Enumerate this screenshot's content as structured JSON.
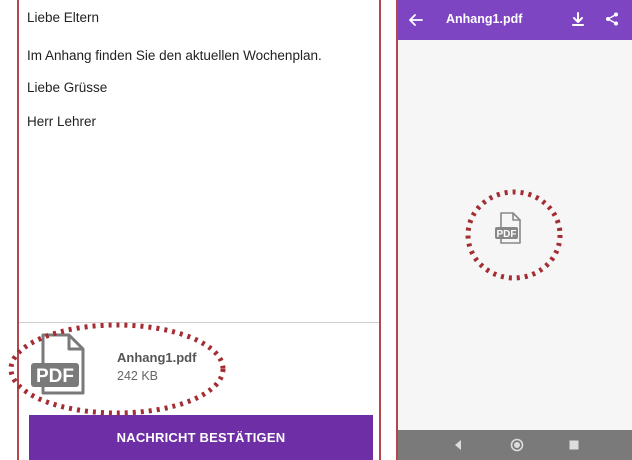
{
  "message": {
    "lines": [
      "Liebe Eltern",
      "Im Anhang finden Sie den aktuellen Wochenplan.",
      "Liebe Grüsse",
      "Herr Lehrer"
    ]
  },
  "attachment": {
    "icon": "pdf-file-icon",
    "icon_text": "PDF",
    "name": "Anhang1.pdf",
    "size": "242 KB"
  },
  "confirm_button": {
    "label": "NACHRICHT BESTÄTIGEN"
  },
  "viewer": {
    "title": "Anhang1.pdf",
    "icons": [
      "back-arrow-icon",
      "download-icon",
      "share-icon"
    ],
    "placeholder_icon": "pdf-file-icon",
    "placeholder_text": "PDF"
  },
  "nav_bar": {
    "icons": [
      "nav-back-icon",
      "nav-home-icon",
      "nav-recent-apps-icon"
    ]
  },
  "colors": {
    "accent_purple": "#6e2fa6",
    "app_bar_purple": "#7e45c3",
    "panel_border": "#b4474a",
    "annotation_dots": "#a32d32",
    "nav_bar": "#7a7a7a"
  }
}
